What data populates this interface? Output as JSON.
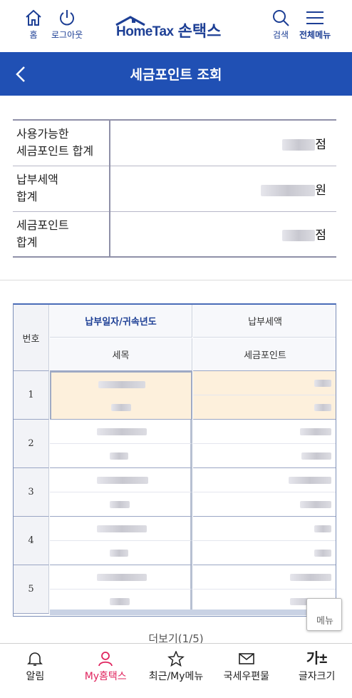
{
  "header": {
    "home_label": "홈",
    "logout_label": "로그아웃",
    "logo_en": "HomeTax",
    "logo_ko": "손택스",
    "search_label": "검색",
    "menu_label": "전체메뉴"
  },
  "titlebar": {
    "title": "세금포인트 조회"
  },
  "summary": {
    "rows": [
      {
        "label_line1": "사용가능한",
        "label_line2": "세금포인트 합계",
        "unit": "점"
      },
      {
        "label_line1": "납부세액",
        "label_line2": "합계",
        "unit": "원"
      },
      {
        "label_line1": "세금포인트",
        "label_line2": "합계",
        "unit": "점"
      }
    ]
  },
  "list": {
    "headers": {
      "number": "번호",
      "pay_date_year": "납부일자/귀속년도",
      "tax_amount": "납부세액",
      "tax_item": "세목",
      "tax_point": "세금포인트"
    },
    "rows": [
      {
        "no": "1"
      },
      {
        "no": "2"
      },
      {
        "no": "3"
      },
      {
        "no": "4"
      },
      {
        "no": "5"
      }
    ]
  },
  "float_menu_label": "메뉴",
  "more_label": "더보기(1/5)",
  "bottom_nav": {
    "alarm": "알림",
    "my_hometax": "My홈택스",
    "recent": "최근/My메뉴",
    "mail": "국세우편물",
    "font_size": "글자크기",
    "font_icon_text": "가±"
  },
  "colors": {
    "brand_blue": "#1d3f95",
    "title_bar": "#2050b4",
    "active_pink": "#e0245e",
    "selected_row": "#fdf0dc"
  }
}
